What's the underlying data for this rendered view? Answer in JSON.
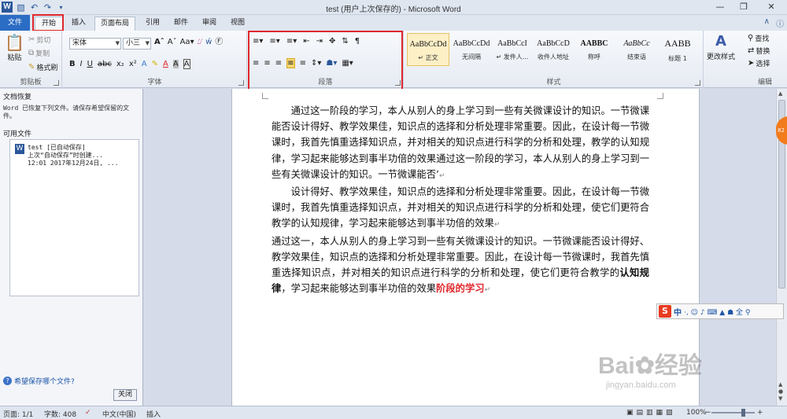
{
  "window": {
    "title": "test (用户上次保存的) - Microsoft Word",
    "app_icon": "W",
    "controls": [
      "—",
      "❐",
      "✕"
    ]
  },
  "quick_access": {
    "save_icon": "save-icon",
    "undo_icon": "undo-icon",
    "redo_icon": "redo-icon"
  },
  "tabs": [
    "文件",
    "开始",
    "插入",
    "页面布局",
    "引用",
    "邮件",
    "审阅",
    "视图"
  ],
  "ribbon": {
    "clipboard": {
      "label": "剪贴板",
      "paste": "粘贴",
      "cut": "剪切",
      "copy": "复制",
      "format_painter": "格式刷"
    },
    "font": {
      "label": "字体",
      "font_name": "宋体",
      "font_size": "小三"
    },
    "paragraph": {
      "label": "段落"
    },
    "styles": {
      "label": "样式",
      "items": [
        {
          "sample": "AaBbCcDd",
          "name": "↵ 正文"
        },
        {
          "sample": "AaBbCcDd",
          "name": "无间隔"
        },
        {
          "sample": "AaBbCcI",
          "name": "↵ 发件人..."
        },
        {
          "sample": "AaBbCcD",
          "name": "收件人地址"
        },
        {
          "sample": "AABBC",
          "name": "称呼"
        },
        {
          "sample": "AaBbCc",
          "name": "结束语"
        },
        {
          "sample": "AABB",
          "name": "标题 1"
        }
      ],
      "change_styles": "更改样式"
    },
    "editing": {
      "label": "编辑",
      "find": "查找",
      "replace": "替换",
      "select": "选择"
    }
  },
  "recovery_pane": {
    "title": "文档恢复",
    "message": "Word 已恢复下列文件。请保存希望保留的文件。",
    "available_label": "可用文件",
    "file": {
      "name": "test  [已自动保存]",
      "line2": "上次“自动保存”时创建...",
      "line3": "12:01 2017年12月24日, ..."
    },
    "help_link": "希望保存哪个文件?",
    "close_button": "关闭"
  },
  "document": {
    "paragraphs": [
      "通过这一阶段的学习，本人从别人的身上学习到一些有关微课设计的知识。一节微课能否设计得好、教学效果佳，知识点的选择和分析处理非常重要。因此，在设计每一节微课时，我首先慎重选择知识点，并对相关的知识点进行科学的分析和处理，教学的认知规律，学习起来能够达到事半功倍的效果通过这一阶段的学习，本人从别人的身上学习到一些有关微课设计的知识。一节微课能否’",
      "设计得好、教学效果佳，知识点的选择和分析处理非常重要。因此，在设计每一节微课时，我首先慎重选择知识点，并对相关的知识点进行科学的分析和处理，使它们更符合教学的认知规律，学习起来能够达到事半功倍的效果",
      "通过这一，本人从别人的身上学习到一些有关微课设计的知识。一节微课能否设计得好、教学效果佳，知识点的选择和分析处理非常重要。因此，在设计每一节微课时，我首先慎重选择知识点，并对相关的知识点进行科学的分析和处理，使它们更符合教学的",
      "认知规律",
      "，学习起来能够达到事半功倍的效果",
      "阶段的学习"
    ]
  },
  "ime_bar": {
    "logo": "S",
    "mode": "中",
    "icons": "·, ☺ ♪ ⌨ ▲ ☗ 全 ⚲"
  },
  "watermark": {
    "brand": "Bai",
    "brand2": "经验",
    "url": "jingyan.baidu.com"
  },
  "status_bar": {
    "page": "页面: 1/1",
    "words": "字数: 408",
    "language": "中文(中国)",
    "mode": "插入",
    "zoom": "100%"
  },
  "side_badge": "82"
}
